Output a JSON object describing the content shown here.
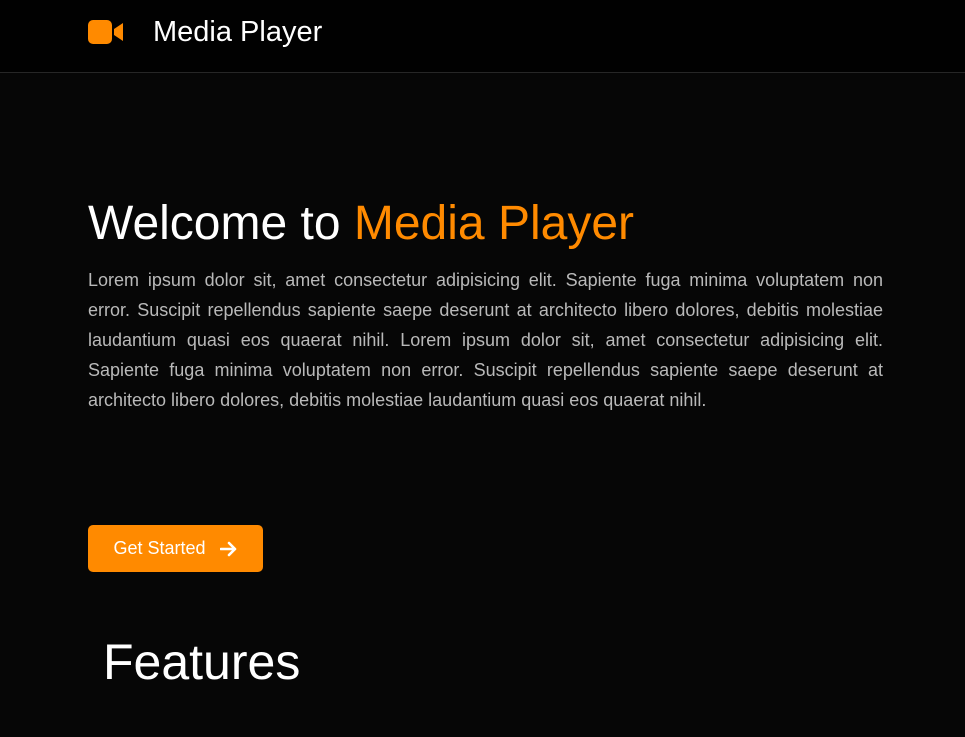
{
  "header": {
    "brand_title": "Media Player",
    "brand_icon": "video-camera-icon"
  },
  "hero": {
    "title_prefix": "Welcome to ",
    "title_accent": "Media Player",
    "description": "Lorem ipsum dolor sit, amet consectetur adipisicing elit. Sapiente fuga minima voluptatem non error. Suscipit repellendus sapiente saepe deserunt at architecto libero dolores, debitis molestiae laudantium quasi eos quaerat nihil. Lorem ipsum dolor sit, amet consectetur adipisicing elit. Sapiente fuga minima voluptatem non error. Suscipit repellendus sapiente saepe deserunt at architecto libero dolores, debitis molestiae laudantium quasi eos quaerat nihil.",
    "cta_label": "Get Started",
    "cta_icon": "arrow-right-icon"
  },
  "features": {
    "heading": "Features"
  },
  "colors": {
    "accent": "#ff8a00",
    "background": "#060606",
    "header_background": "#010101",
    "body_text": "#b9b9b9",
    "heading_text": "#ffffff"
  }
}
